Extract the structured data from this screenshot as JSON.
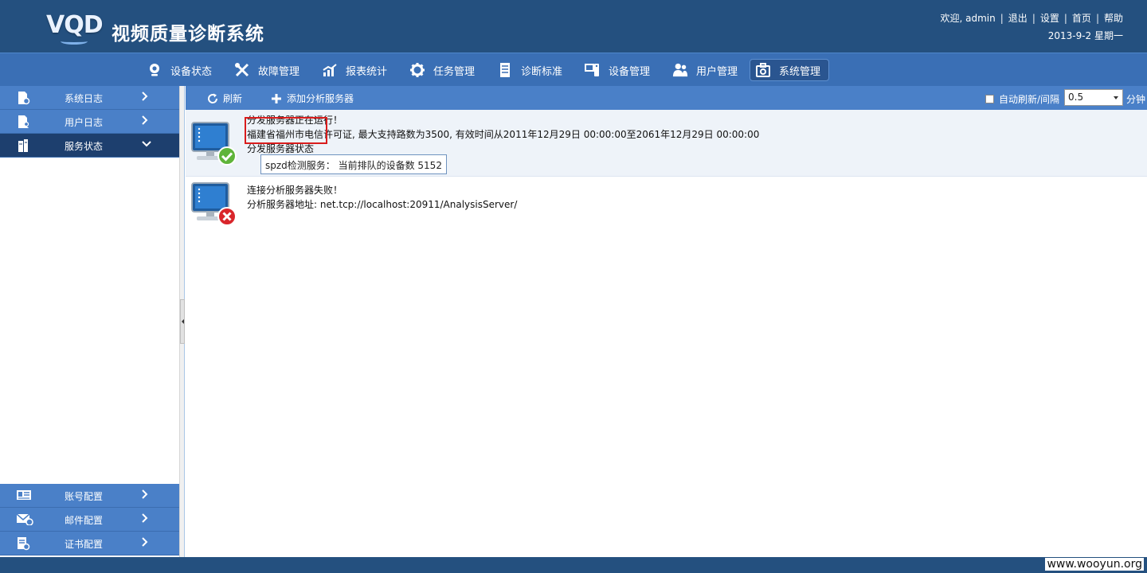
{
  "header": {
    "logo_text": "VQD",
    "title": "视频质量诊断系统",
    "welcome": "欢迎, admin",
    "links": [
      "退出",
      "设置",
      "首页",
      "帮助"
    ],
    "date": "2013-9-2 星期一"
  },
  "nav": {
    "items": [
      {
        "label": "设备状态",
        "icon": "webcam-icon"
      },
      {
        "label": "故障管理",
        "icon": "tools-icon"
      },
      {
        "label": "报表统计",
        "icon": "chart-icon"
      },
      {
        "label": "任务管理",
        "icon": "gear-icon"
      },
      {
        "label": "诊断标准",
        "icon": "book-icon"
      },
      {
        "label": "设备管理",
        "icon": "device-icon"
      },
      {
        "label": "用户管理",
        "icon": "users-icon"
      },
      {
        "label": "系统管理",
        "icon": "toolbox-icon"
      }
    ],
    "active": "系统管理"
  },
  "sidebar": {
    "top_items": [
      {
        "label": "系统日志",
        "icon": "doc-gear-icon"
      },
      {
        "label": "用户日志",
        "icon": "doc-user-icon"
      },
      {
        "label": "服务状态",
        "icon": "server-icon"
      }
    ],
    "bottom_items": [
      {
        "label": "账号配置",
        "icon": "id-card-icon"
      },
      {
        "label": "邮件配置",
        "icon": "mail-icon"
      },
      {
        "label": "证书配置",
        "icon": "certificate-icon"
      }
    ]
  },
  "toolbar": {
    "refresh_label": "刷新",
    "add_label": "添加分析服务器",
    "auto_refresh_label": "自动刷新/间隔",
    "interval_value": "0.5",
    "unit_label": "分钟"
  },
  "servers": {
    "dispatch": {
      "line1": "分发服务器正在运行！",
      "line2": "福建省福州市电信许可证, 最大支持路数为3500, 有效时间从2011年12月29日 00:00:00至2061年12月29日 00:00:00",
      "line3": "分发服务器状态",
      "status": "spzd检测服务：  当前排队的设备数  5152"
    },
    "analysis": {
      "line1": "连接分析服务器失败！",
      "line2": "分析服务器地址:  net.tcp://localhost:20911/AnalysisServer/"
    }
  },
  "watermark": "www.wooyun.org",
  "colors": {
    "header_bg": "#24507f",
    "nav_bg": "#3a6fb5",
    "sidebar_item_bg": "#4a80c8",
    "sidebar_active_bg": "#1d3f6e",
    "highlight_border": "#d91c1c"
  }
}
